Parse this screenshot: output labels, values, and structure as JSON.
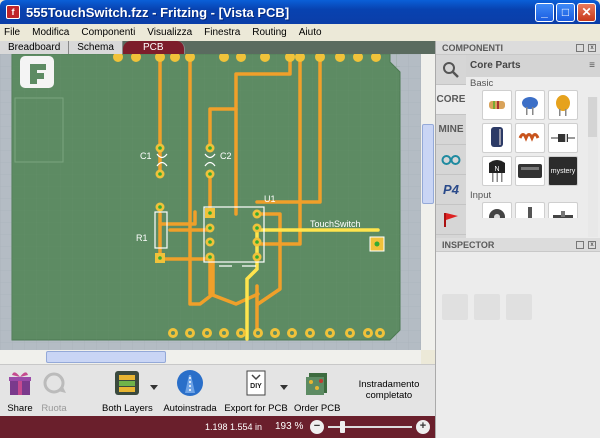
{
  "window": {
    "title": "555TouchSwitch.fzz - Fritzing - [Vista PCB]",
    "controls": {
      "minimize": "_",
      "maximize": "□",
      "close": "✕"
    }
  },
  "menu": [
    "File",
    "Modifica",
    "Componenti",
    "Visualizza",
    "Finestra",
    "Routing",
    "Aiuto"
  ],
  "view_tabs": [
    {
      "label": "Breadboard",
      "active": false
    },
    {
      "label": "Schema",
      "active": false
    },
    {
      "label": "PCB",
      "active": true
    }
  ],
  "pcb": {
    "labels": {
      "c1": "C1",
      "c2": "C2",
      "r1": "R1",
      "u1": "U1",
      "touch": "TouchSwitch"
    },
    "colors": {
      "board": "#5d8b63",
      "trace": "#f0a02a",
      "trace_selected": "#ffe44d",
      "pad": "#f0c23a",
      "pad_hole": "#33aa33",
      "background": "#b4bcc4"
    }
  },
  "toolbar": {
    "share": "Share",
    "undo": "Ruota",
    "layers": "Both Layers",
    "autoroute": "Autoinstrada",
    "export": "Export for PCB",
    "order": "Order PCB",
    "routing_status_line1": "Instradamento",
    "routing_status_line2": "completato"
  },
  "status": {
    "coords": "1.198 1.554 in",
    "zoom": "193 %",
    "zoom_out": "−",
    "zoom_in": "+"
  },
  "components_panel": {
    "title": "COMPONENTI",
    "bin_title": "Core Parts",
    "bins": [
      {
        "label": "",
        "icon": "search-icon"
      },
      {
        "label": "CORE",
        "icon": ""
      },
      {
        "label": "MINE",
        "icon": ""
      },
      {
        "label": "",
        "icon": "arduino-icon"
      },
      {
        "label": "P4",
        "icon": ""
      },
      {
        "label": "",
        "icon": "flag-icon"
      },
      {
        "label": "",
        "icon": "more-bins-icon"
      }
    ],
    "section_basic": "Basic",
    "section_input": "Input",
    "parts_basic": [
      {
        "name": "resistor",
        "color": "#d9a35a"
      },
      {
        "name": "ceramic-capacitor",
        "color": "#3c6fc7"
      },
      {
        "name": "tantalum-capacitor",
        "color": "#e6a21d"
      },
      {
        "name": "electrolytic-capacitor",
        "color": "#2c3a66"
      },
      {
        "name": "inductor",
        "color": "#c8541d"
      },
      {
        "name": "diode",
        "color": "#333333"
      },
      {
        "name": "transistor",
        "color": "#222222"
      },
      {
        "name": "battery",
        "color": "#333333"
      },
      {
        "name": "mystery-part",
        "color": "#2b2b2b",
        "label": "mystery"
      }
    ],
    "parts_input": [
      {
        "name": "potentiometer",
        "color": "#444444"
      },
      {
        "name": "pushbutton",
        "color": "#555555"
      },
      {
        "name": "switch",
        "color": "#444444"
      }
    ]
  },
  "inspector_panel": {
    "title": "INSPECTOR"
  }
}
